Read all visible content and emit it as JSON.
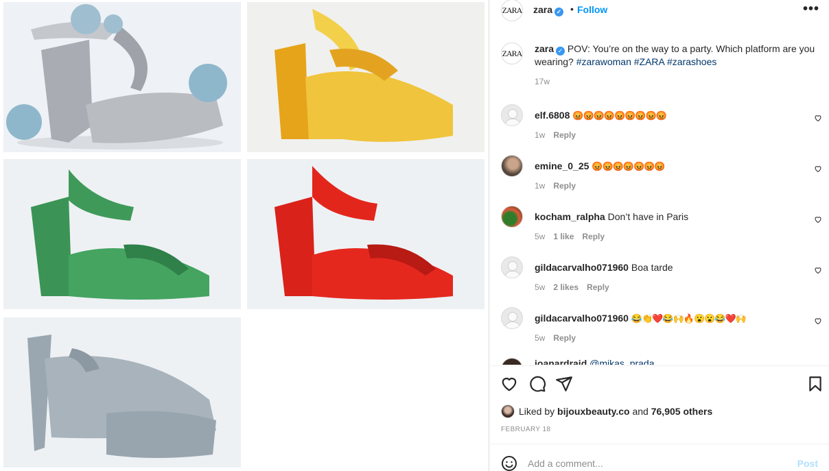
{
  "post": {
    "username": "zara",
    "logo_text": "ZARA",
    "follow_label": "Follow",
    "more_label": "•••",
    "separator": "•",
    "caption": {
      "username": "zara",
      "text_before": "POV: You’re on the way to a party. Which platform are you wearing? ",
      "hashtags": [
        "#zarawoman",
        "#ZARA",
        "#zarashoes"
      ],
      "age": "17w"
    }
  },
  "media": {
    "photos": [
      {
        "name": "silver-glitter-platform-sandal",
        "color": "#b9bcc2"
      },
      {
        "name": "yellow-wax-platform-sandal",
        "color": "#e9b922"
      },
      {
        "name": "green-platform-sandal",
        "color": "#3f9a5a"
      },
      {
        "name": "red-platform-sandal",
        "color": "#e3261c"
      },
      {
        "name": "grey-suede-platform-mule",
        "color": "#a8b3bb"
      }
    ]
  },
  "comments": [
    {
      "username": "elf.6808",
      "text": "😡😡😡😡😡😡😡😡😡",
      "age": "1w",
      "likes": "",
      "reply": "Reply"
    },
    {
      "username": "emine_0_25",
      "text": "😡😡😡😡😡😡😡",
      "age": "1w",
      "likes": "",
      "reply": "Reply"
    },
    {
      "username": "kocham_ralpha",
      "text": "Don’t have in Paris",
      "age": "5w",
      "likes": "1 like",
      "reply": "Reply"
    },
    {
      "username": "gildacarvalho071960",
      "text": "Boa tarde",
      "age": "5w",
      "likes": "2 likes",
      "reply": "Reply"
    },
    {
      "username": "gildacarvalho071960",
      "text": "😂👏❤️😂🙌🔥😮😮😂❤️🙌",
      "age": "5w",
      "likes": "",
      "reply": "Reply"
    }
  ],
  "partial_comment": {
    "username": "ioanardraid",
    "text": "@mikas_prada"
  },
  "likes": {
    "prefix": "Liked by",
    "by_user": "bijouxbeauty.co",
    "middle": "and",
    "others": "76,905 others"
  },
  "date": "FEBRUARY 18",
  "add_comment": {
    "placeholder": "Add a comment...",
    "post_label": "Post"
  },
  "colors": {
    "link_blue": "#0095f6",
    "hashtag": "#00376b",
    "muted": "#8e8e8e",
    "post_disabled": "#b2dffc"
  }
}
